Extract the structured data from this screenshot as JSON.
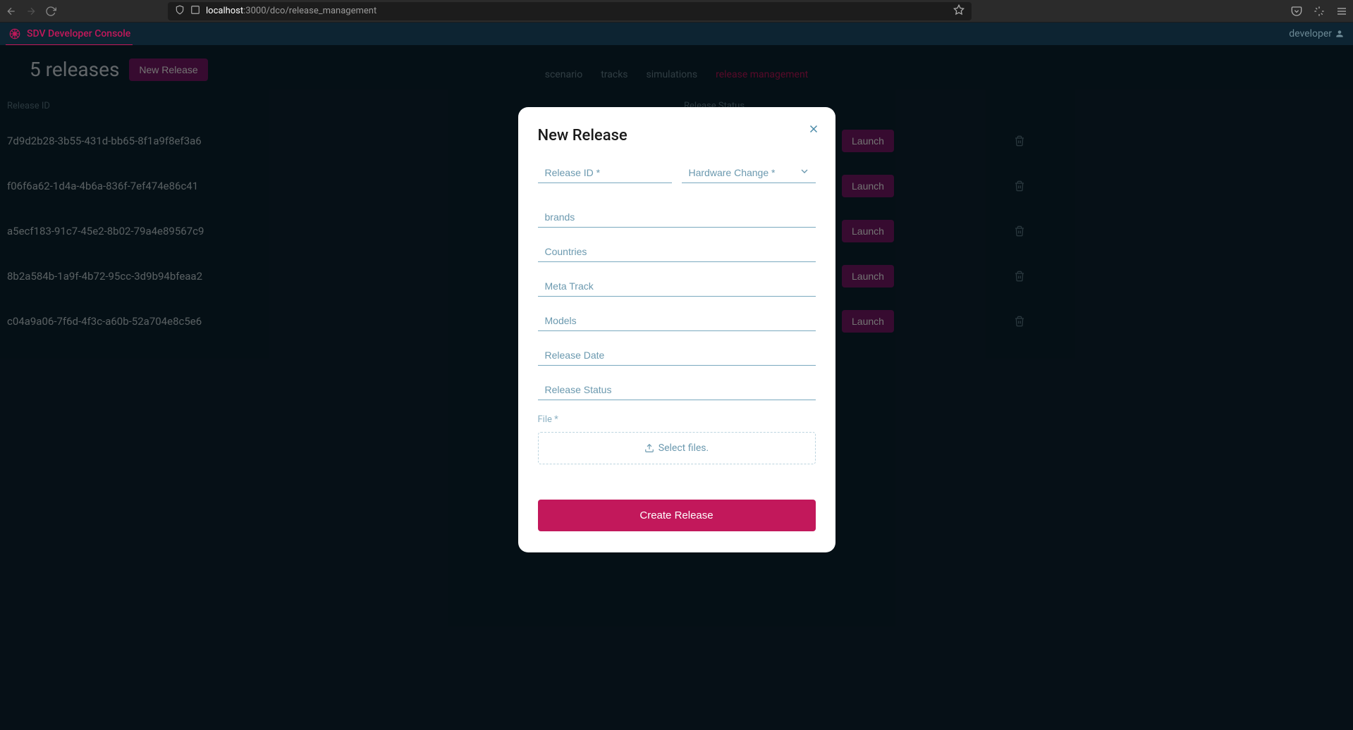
{
  "browser": {
    "url_host": "localhost",
    "url_port_path": ":3000/dco/release_management"
  },
  "app": {
    "title": "SDV Developer Console",
    "user_label": "developer"
  },
  "page": {
    "heading": "5 releases",
    "new_release_label": "New Release"
  },
  "nav_tabs": {
    "scenario": "scenario",
    "tracks": "tracks",
    "simulations": "simulations",
    "release_management": "release management"
  },
  "columns": {
    "id": "Release ID",
    "status": "Release Status"
  },
  "releases": [
    {
      "id": "7d9d2b28-3b55-431d-bb65-8f1a9f8ef3a6"
    },
    {
      "id": "f06f6a62-1d4a-4b6a-836f-7ef474e86c41"
    },
    {
      "id": "a5ecf183-91c7-45e2-8b02-79a4e89567c9"
    },
    {
      "id": "8b2a584b-1a9f-4b72-95cc-3d9b94bfeaa2"
    },
    {
      "id": "c04a9a06-7f6d-4f3c-a60b-52a704e8c5e6"
    }
  ],
  "row_actions": {
    "launch": "Launch"
  },
  "modal": {
    "title": "New Release",
    "fields": {
      "release_id": "Release ID *",
      "hardware_change": "Hardware Change *",
      "brands": "brands",
      "countries": "Countries",
      "meta_track": "Meta Track",
      "models": "Models",
      "release_date": "Release Date",
      "release_status": "Release Status"
    },
    "file_label": "File *",
    "select_files": "Select files.",
    "create_label": "Create Release"
  },
  "colors": {
    "accent": "#c2185b",
    "accent_alt": "#7a1a6a",
    "bg_dark": "#0d2432"
  }
}
